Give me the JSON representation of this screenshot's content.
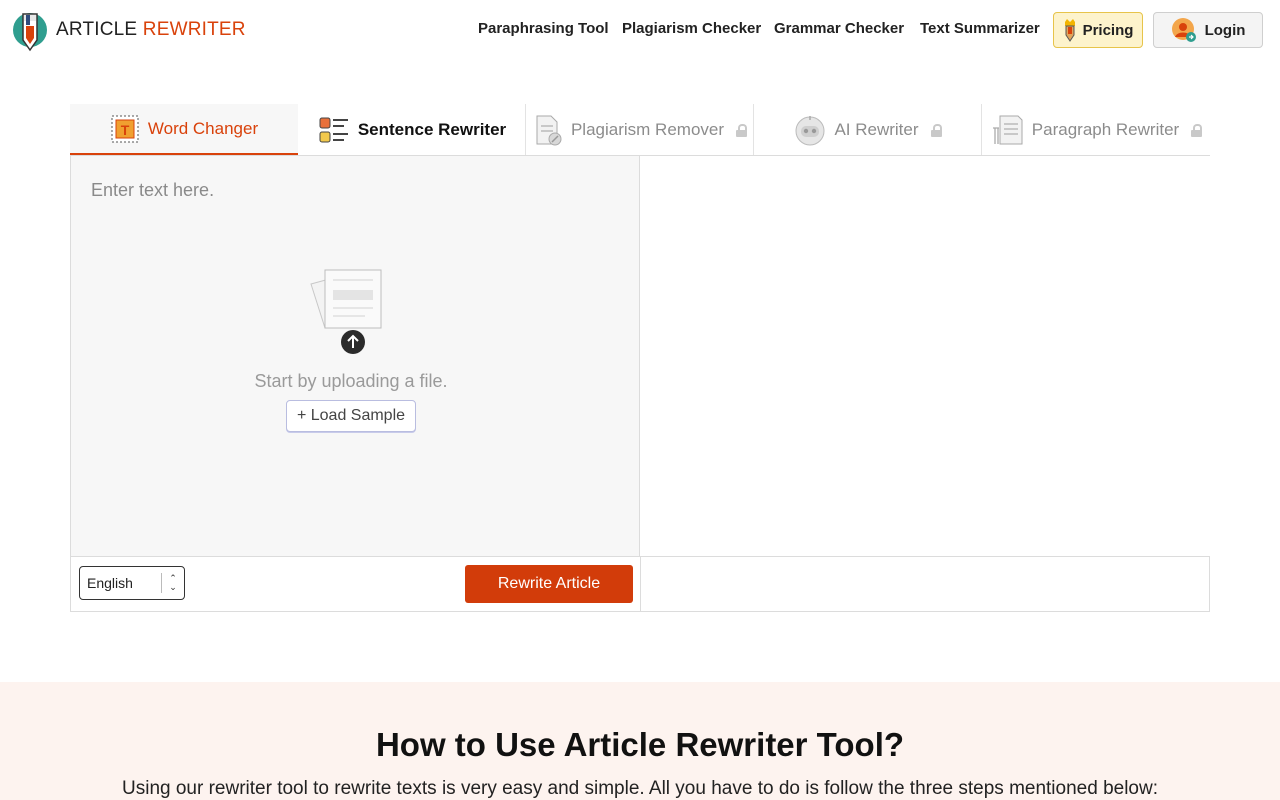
{
  "brand": {
    "name_part1": "ARTICLE ",
    "name_part2": "REWRITER",
    "accent_color": "#d9420b"
  },
  "nav": {
    "links": [
      "Paraphrasing Tool",
      "Plagiarism Checker",
      "Grammar Checker",
      "Text Summarizer"
    ],
    "pricing_label": "Pricing",
    "login_label": "Login"
  },
  "tabs": [
    {
      "label": "Word Changer",
      "icon": "word-changer-icon",
      "active": true,
      "locked": false
    },
    {
      "label": "Sentence Rewriter",
      "icon": "sentence-list-icon",
      "active": false,
      "locked": false
    },
    {
      "label": "Plagiarism Remover",
      "icon": "document-icon",
      "active": false,
      "locked": true
    },
    {
      "label": "AI Rewriter",
      "icon": "robot-icon",
      "active": false,
      "locked": true
    },
    {
      "label": "Paragraph Rewriter",
      "icon": "paragraph-icon",
      "active": false,
      "locked": true
    }
  ],
  "editor": {
    "placeholder": "Enter text here.",
    "upload_text": "Start by uploading a file.",
    "load_sample_label": "+ Load Sample",
    "language": "English",
    "rewrite_label": "Rewrite Article"
  },
  "howto": {
    "title": "How to Use Article Rewriter Tool?",
    "description": "Using our rewriter tool to rewrite texts is very easy and simple. All you have to do is follow the three steps mentioned below:"
  }
}
